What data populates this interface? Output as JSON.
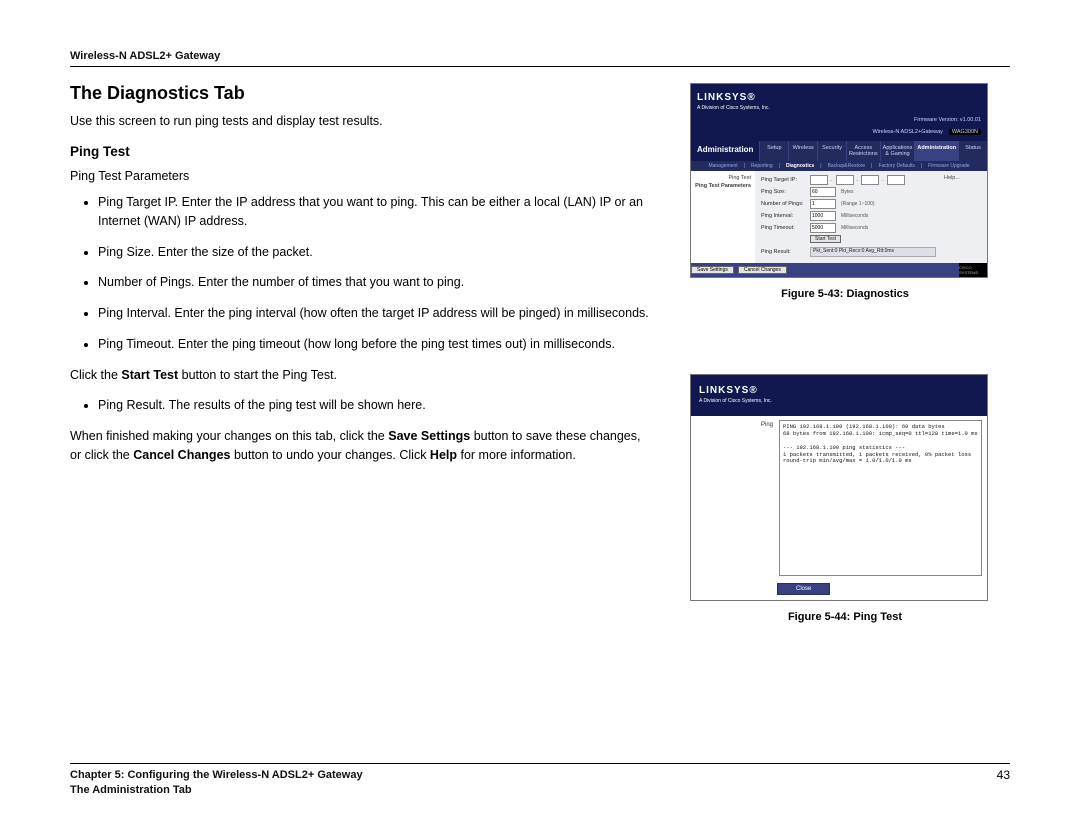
{
  "header": {
    "product": "Wireless-N ADSL2+ Gateway"
  },
  "section_title": "The Diagnostics Tab",
  "intro": "Use this screen to run ping tests and display test results.",
  "subheading": "Ping Test",
  "params_label": "Ping Test Parameters",
  "bullets1": [
    "Ping Target IP. Enter the IP address that you want to ping. This can be either a local (LAN) IP or an Internet (WAN) IP address.",
    "Ping Size. Enter the size of the packet.",
    "Number of Pings. Enter the number of times that you want to ping.",
    "Ping Interval. Enter the ping interval (how often the target IP address will be pinged) in milliseconds.",
    "Ping Timeout. Enter the ping timeout (how long before the ping test times out) in milliseconds."
  ],
  "mid_sentence": {
    "pre": "Click the ",
    "bold": "Start Test",
    "post": " button to start the Ping Test."
  },
  "bullets2": [
    "Ping Result. The results of the ping test will be shown here."
  ],
  "closing": {
    "pre": "When finished making your changes on this tab, click the ",
    "b1": "Save Settings",
    "mid1": " button to save these changes, or click the ",
    "b2": "Cancel Changes",
    "mid2": " button to undo your changes. Click ",
    "b3": "Help",
    "post": " for more information."
  },
  "figure43": {
    "caption": "Figure 5-43: Diagnostics",
    "brand": "LINKSYS®",
    "brandsub": "A Division of Cisco Systems, Inc.",
    "prod_right1": "Wireless-N ADSL2+Gateway",
    "prod_right2": "WAG300N",
    "firmware": "Firmware Version: v1.00.01",
    "navlabel": "Administration",
    "tabs": [
      "Setup",
      "Wireless",
      "Security",
      "Access Restrictions",
      "Applications & Gaming",
      "Administration",
      "Status"
    ],
    "subtabs": [
      "Management",
      "Reporting",
      "Diagnostics",
      "Backup&Restore",
      "Factory Defaults",
      "Firmware Upgrade"
    ],
    "sidelabel": "Ping Test",
    "paramslabel": "Ping Test Parameters",
    "rows": {
      "target": "Ping Target IP:",
      "size": "Ping Size:",
      "size_val": "60",
      "size_unit": "Bytes",
      "num": "Number of Pings:",
      "num_val": "1",
      "num_hint": "(Range 1~100)",
      "interval": "Ping Interval:",
      "interval_val": "1000",
      "interval_unit": "Milliseconds",
      "timeout": "Ping Timeout:",
      "timeout_val": "5000",
      "timeout_unit": "Milliseconds",
      "startbtn": "Start Test",
      "resultlbl": "Ping Result:",
      "result_val": "Pkt_Sent:0 Pkt_Recv:0 Avg_Rtt:0ms"
    },
    "helplabel": "Help...",
    "save": "Save Settings",
    "cancel": "Cancel Changes",
    "cisco": "CISCO SYSTEMS"
  },
  "figure44": {
    "caption": "Figure 5-44: Ping Test",
    "brand": "LINKSYS®",
    "brandsub": "A Division of Cisco Systems, Inc.",
    "sidelabel": "Ping",
    "terminal": "PING 192.168.1.100 (192.168.1.100): 60 data bytes\n68 bytes from 192.168.1.100: icmp_seq=0 ttl=128 time=1.0 ms\n\n--- 192.168.1.100 ping statistics ---\n1 packets transmitted, 1 packets received, 0% packet loss\nround-trip min/avg/max = 1.0/1.0/1.0 ms",
    "close": "Close"
  },
  "footer": {
    "chapter": "Chapter 5: Configuring the Wireless-N ADSL2+ Gateway",
    "tab": "The Administration Tab",
    "pagenum": "43"
  }
}
